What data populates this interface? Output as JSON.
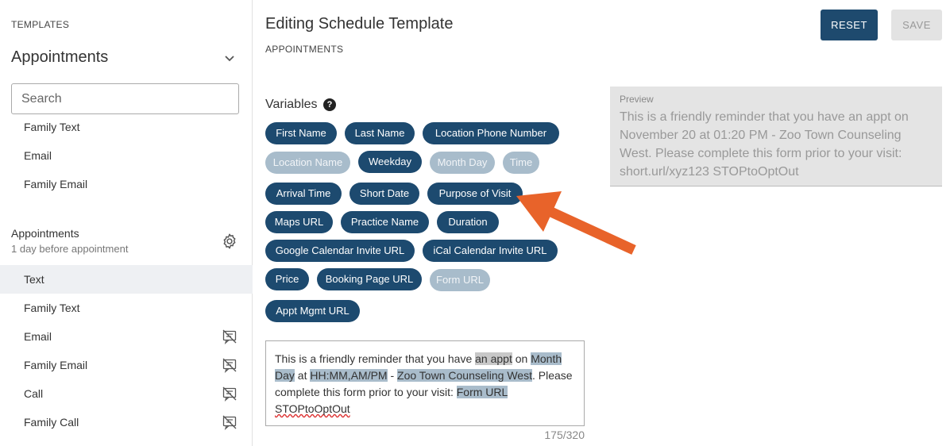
{
  "sidebar": {
    "caption": "TEMPLATES",
    "title": "Appointments",
    "search_placeholder": "Search",
    "top_items": [
      "Family Text",
      "Email",
      "Family Email"
    ],
    "group_title": "Appointments",
    "group_subtitle": "1 day before appointment",
    "items": [
      {
        "label": "Text",
        "active": true,
        "icon": "no-message-icon",
        "show_icon": false
      },
      {
        "label": "Family Text",
        "active": false,
        "icon": "no-message-icon",
        "show_icon": false
      },
      {
        "label": "Email",
        "active": false,
        "icon": "no-message-icon",
        "show_icon": true
      },
      {
        "label": "Family Email",
        "active": false,
        "icon": "no-message-icon",
        "show_icon": true
      },
      {
        "label": "Call",
        "active": false,
        "icon": "no-message-icon",
        "show_icon": true
      },
      {
        "label": "Family Call",
        "active": false,
        "icon": "no-message-icon",
        "show_icon": true
      }
    ]
  },
  "main": {
    "title": "Editing Schedule Template",
    "subtitle": "APPOINTMENTS",
    "reset_label": "RESET",
    "save_label": "SAVE",
    "variables_label": "Variables",
    "help_glyph": "?",
    "variables": [
      {
        "label": "First Name",
        "enabled": true
      },
      {
        "label": "Last Name",
        "enabled": true
      },
      {
        "label": "Location Phone Number",
        "enabled": true
      },
      {
        "label": "Location Name",
        "enabled": false
      },
      {
        "label": "Weekday",
        "enabled": true
      },
      {
        "label": "Month Day",
        "enabled": false
      },
      {
        "label": "Time",
        "enabled": false
      },
      {
        "label": "Arrival Time",
        "enabled": true
      },
      {
        "label": "Short Date",
        "enabled": true
      },
      {
        "label": "Purpose of Visit",
        "enabled": true
      },
      {
        "label": "Maps URL",
        "enabled": true
      },
      {
        "label": "Practice Name",
        "enabled": true
      },
      {
        "label": "Duration",
        "enabled": true
      },
      {
        "label": "Google Calendar Invite URL",
        "enabled": true
      },
      {
        "label": "iCal Calendar Invite URL",
        "enabled": true
      },
      {
        "label": "Price",
        "enabled": true
      },
      {
        "label": "Booking Page URL",
        "enabled": true
      },
      {
        "label": "Form URL",
        "enabled": false
      },
      {
        "label": "Appt Mgmt URL",
        "enabled": true
      }
    ],
    "editor": {
      "t1": "This is a friendly reminder that you have ",
      "v1": "an appt",
      "t2": " on ",
      "v2": "Month Day",
      "t3": " at ",
      "v3": "HH:MM,AM/PM",
      "t4": " - ",
      "v4": "Zoo Town Counseling West",
      "t5": ". Please complete this form prior to your visit: ",
      "v5": "Form URL ",
      "t6": " ",
      "v6": "STOPtoOptOut"
    },
    "counter": "175/320",
    "preview_label": "Preview",
    "preview_text": "This is a friendly reminder that you have an appt on November 20 at 01:20 PM - Zoo Town Counseling West. Please complete this form prior to your visit: short.url/xyz123  STOPtoOptOut"
  },
  "colors": {
    "chip_enabled": "#1d4a6f",
    "chip_disabled": "#a8bccb",
    "primary_button": "#1e4a6e",
    "annotation_arrow": "#e8632a"
  }
}
